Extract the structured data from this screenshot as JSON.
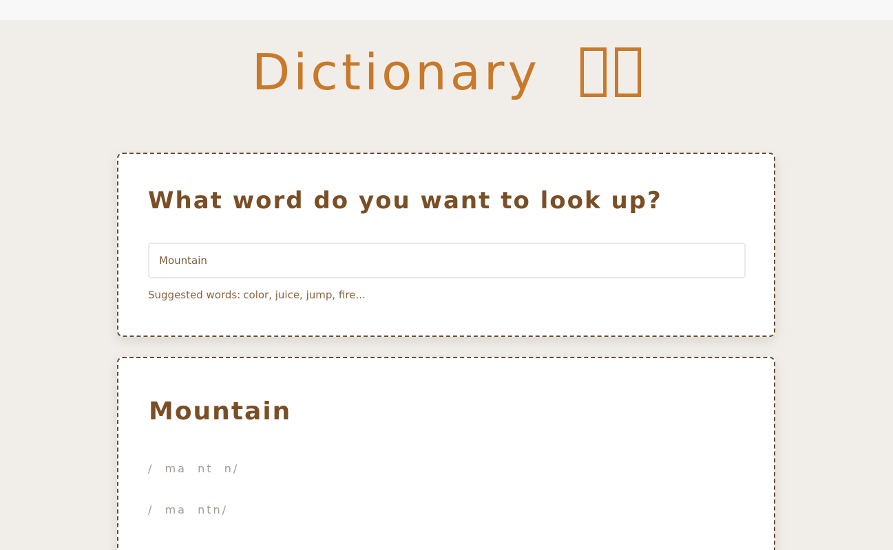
{
  "header": {
    "title": "Dictionary"
  },
  "search": {
    "heading": "What word do you want to look up?",
    "input_value": "Mountain",
    "suggested_label": "Suggested words:",
    "suggested_words": "color, juice, jump, fire..."
  },
  "result": {
    "word": "Mountain",
    "phonetics": [
      "/  ma  nt  n/",
      "/  ma  ntn/"
    ]
  },
  "colors": {
    "accent": "#c8792a",
    "heading": "#7a4f26",
    "background": "#f1eee9",
    "card_border": "#6b4a2e"
  }
}
